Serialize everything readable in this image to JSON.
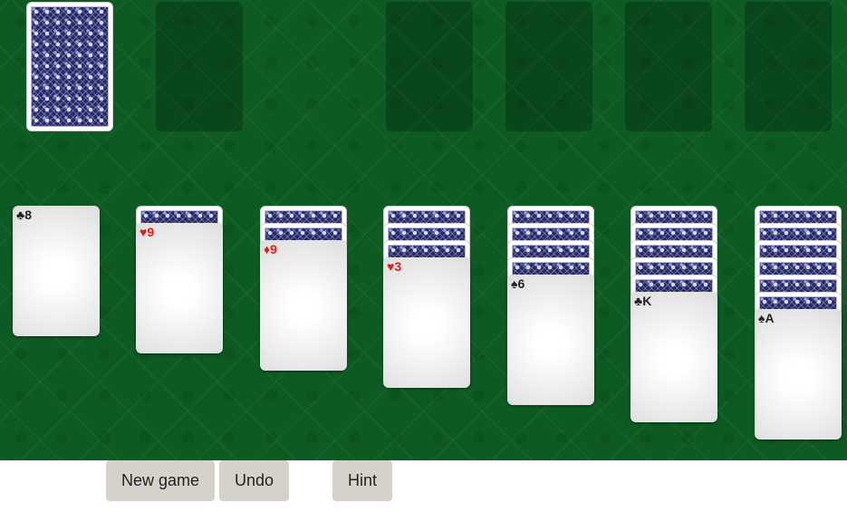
{
  "colors": {
    "felt": "#0d5a23",
    "card_back": "#262a6b",
    "red_suit": "#e31b1b",
    "black_suit": "#222222",
    "button_bg": "#d5d2cb"
  },
  "stock": {
    "cards": 1,
    "icon": "card-back-icon"
  },
  "foundations": {
    "empty_slots": 5
  },
  "tableau": [
    {
      "hidden_cards": 0,
      "top_card": {
        "label": "♣8",
        "suit": "clubs",
        "rank": "8",
        "color": "black"
      }
    },
    {
      "hidden_cards": 1,
      "top_card": {
        "label": "♥9",
        "suit": "hearts",
        "rank": "9",
        "color": "red"
      }
    },
    {
      "hidden_cards": 2,
      "top_card": {
        "label": "♦9",
        "suit": "diamonds",
        "rank": "9",
        "color": "red"
      }
    },
    {
      "hidden_cards": 3,
      "top_card": {
        "label": "♥3",
        "suit": "hearts",
        "rank": "3",
        "color": "red"
      }
    },
    {
      "hidden_cards": 4,
      "top_card": {
        "label": "♠6",
        "suit": "spades",
        "rank": "6",
        "color": "black"
      }
    },
    {
      "hidden_cards": 5,
      "top_card": {
        "label": "♣K",
        "suit": "clubs",
        "rank": "K",
        "color": "black"
      }
    },
    {
      "hidden_cards": 6,
      "top_card": {
        "label": "♠A",
        "suit": "spades",
        "rank": "A",
        "color": "black"
      }
    }
  ],
  "buttons": {
    "new_game": "New game",
    "undo": "Undo",
    "hint": "Hint"
  }
}
